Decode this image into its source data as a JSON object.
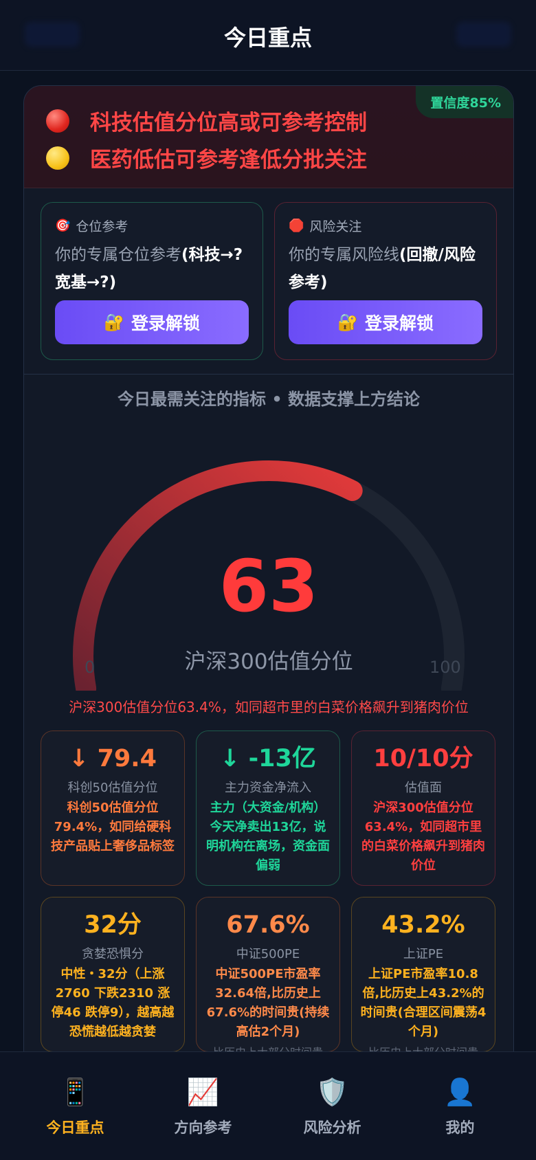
{
  "header": {
    "title": "今日重点"
  },
  "alert": {
    "confidence": "置信度85%",
    "lines": [
      {
        "icon": "red-circle-icon",
        "text": "科技估值分位高或可参考控制"
      },
      {
        "icon": "yellow-circle-icon",
        "text": "医药低估可参考逢低分批关注"
      }
    ]
  },
  "position_box": {
    "title": "仓位参考",
    "desc_prefix": "你的专属仓位参考",
    "desc_bold": "(科技→?宽基→?)",
    "button": "登录解锁"
  },
  "risk_box": {
    "title": "风险关注",
    "desc_prefix": "你的专属风险线",
    "desc_bold": "(回撤/风险参考)",
    "button": "登录解锁"
  },
  "gauge": {
    "section_title": "今日最需关注的指标 • 数据支撑上方结论",
    "value": "63",
    "percent": 63.4,
    "label": "沪深300估值分位",
    "min_label": "0",
    "max_label": "100",
    "summary": "沪深300估值分位63.4%，如同超市里的白菜价格飙升到猪肉价位"
  },
  "metrics": [
    {
      "value": "↓ 79.4",
      "name": "科创50估值分位",
      "detail": "科创50估值分位79.4%，如同给硬科技产品贴上奢侈品标签",
      "note": ""
    },
    {
      "value": "↓ -13亿",
      "name": "主力资金净流入",
      "detail": "主力（大资金/机构）今天净卖出13亿，说明机构在离场，资金面偏弱",
      "note": ""
    },
    {
      "value": "10/10分",
      "name": "估值面",
      "detail": "沪深300估值分位63.4%，如同超市里的白菜价格飙升到猪肉价位",
      "note": ""
    },
    {
      "value": "32分",
      "name": "贪婪恐惧分",
      "detail": "中性・32分（上涨2760 下跌2310 涨停46 跌停9），越高越恐慌越低越贪婪",
      "note": ""
    },
    {
      "value": "67.6%",
      "name": "中证500PE",
      "detail": "中证500PE市盈率32.64倍,比历史上67.6%的时间贵(持续高估2个月)",
      "note": "比历史上大部分时间贵"
    },
    {
      "value": "43.2%",
      "name": "上证PE",
      "detail": "上证PE市盈率10.8倍,比历史上43.2%的时间贵(合理区间震荡4个月)",
      "note": "比历史上大部分时间贵"
    }
  ],
  "nav": [
    {
      "label": "今日重点",
      "icon": "phone-icon",
      "active": true
    },
    {
      "label": "方向参考",
      "icon": "chart-up-icon",
      "active": false
    },
    {
      "label": "风险分析",
      "icon": "shield-icon",
      "active": false
    },
    {
      "label": "我的",
      "icon": "user-icon",
      "active": false
    }
  ],
  "colors": {
    "accent_red": "#ff3b3b",
    "accent_green": "#1fd69a",
    "accent_amber": "#ffb21f",
    "button_purple": "#7a5cff"
  }
}
